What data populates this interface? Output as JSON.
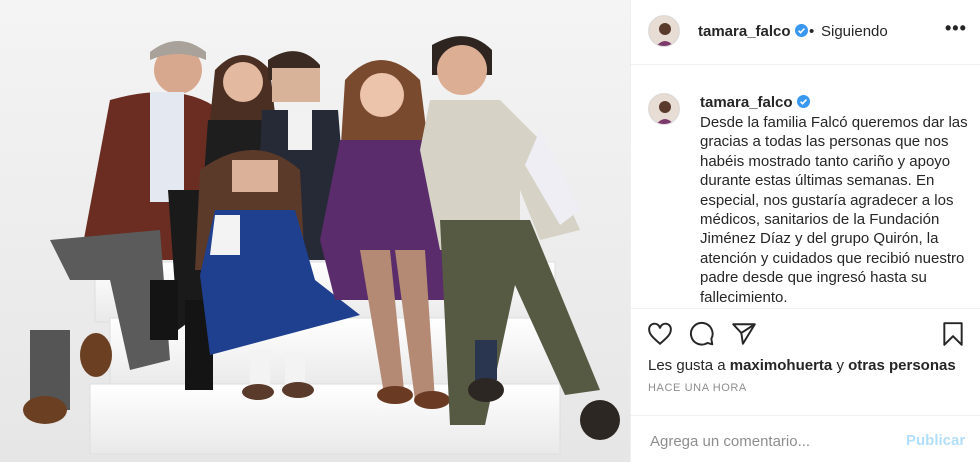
{
  "post": {
    "username": "tamara_falco",
    "verified_icon": "verified-badge-icon",
    "separator": "•",
    "follow_status": "Siguiendo",
    "more_label": "•••",
    "caption": "Desde la familia Falcó queremos dar las gracias a todas las personas que nos habéis mostrado tanto cariño y apoyo durante estas últimas semanas. En especial, nos gustaría agradecer a los médicos, sanitarios de la Fundación Jiménez Díaz y del grupo Quirón, la atención y cuidados que recibió nuestro padre desde que ingresó hasta su fallecimiento.",
    "likes_prefix": "Les gusta a",
    "likes_user": "maximohuerta",
    "likes_conj": "y",
    "likes_others": "otras personas",
    "time": "HACE UNA HORA"
  },
  "actions": {
    "icons": [
      "heart-icon",
      "comment-icon",
      "share-icon",
      "bookmark-icon"
    ]
  },
  "comment": {
    "placeholder": "Agrega un comentario...",
    "value": "",
    "post_label": "Publicar"
  },
  "colors": {
    "verified": "#3897f0",
    "link_disabled": "#b2dffc",
    "muted": "#8e8e8e",
    "text": "#262626"
  }
}
